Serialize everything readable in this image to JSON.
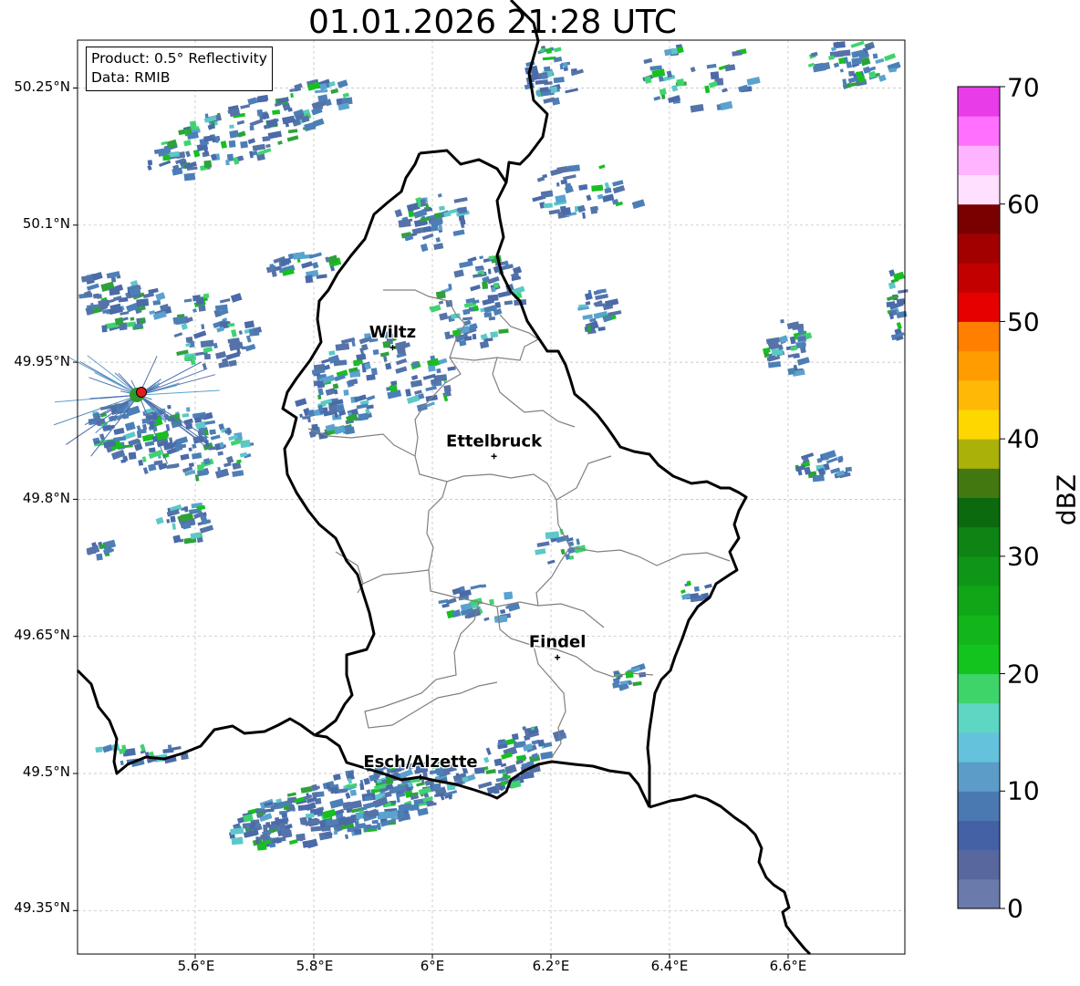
{
  "title": "01.01.2026 21:28 UTC",
  "info": {
    "product": "Product: 0.5° Reflectivity",
    "source": "Data: RMIB"
  },
  "lat_labels": [
    "50.25°N",
    "50.1°N",
    "49.95°N",
    "49.8°N",
    "49.65°N",
    "49.5°N",
    "49.35°N"
  ],
  "lon_labels": [
    "5.6°E",
    "5.8°E",
    "6°E",
    "6.2°E",
    "6.4°E",
    "6.6°E"
  ],
  "cities": [
    {
      "name": "Wiltz",
      "lat": 49.966,
      "lon": 5.933
    },
    {
      "name": "Ettelbruck",
      "lat": 49.847,
      "lon": 6.104
    },
    {
      "name": "Findel",
      "lat": 49.627,
      "lon": 6.211
    },
    {
      "name": "Esch/Alzette",
      "lat": 49.496,
      "lon": 5.98
    }
  ],
  "radar_site": {
    "lat": 49.914,
    "lon": 5.505
  },
  "colorbar": {
    "label": "dBZ",
    "tick_labels": [
      "0",
      "10",
      "20",
      "30",
      "40",
      "50",
      "60",
      "70"
    ],
    "min": 0,
    "max": 70,
    "step": 2.5,
    "colors": [
      "#6a7aab",
      "#58689f",
      "#4561a5",
      "#4a78b1",
      "#5b9cc9",
      "#65c2dc",
      "#5dd6c4",
      "#3ed46a",
      "#14c41e",
      "#12b61a",
      "#11a618",
      "#0f9616",
      "#0d8414",
      "#0b6a0e",
      "#437810",
      "#aab20a",
      "#ffd700",
      "#ffb806",
      "#ff9c00",
      "#ff8000",
      "#e60000",
      "#c30000",
      "#a20000",
      "#7a0000",
      "#ffe0ff",
      "#ffb4ff",
      "#ff70ff",
      "#e83ce8"
    ]
  },
  "echo_colors": [
    "#4a6aa8",
    "#5573a8",
    "#4d7fb7",
    "#5aa3cf",
    "#5cc8c8",
    "#3fd370",
    "#17c01f",
    "#2ea23a",
    "#e8b400"
  ]
}
